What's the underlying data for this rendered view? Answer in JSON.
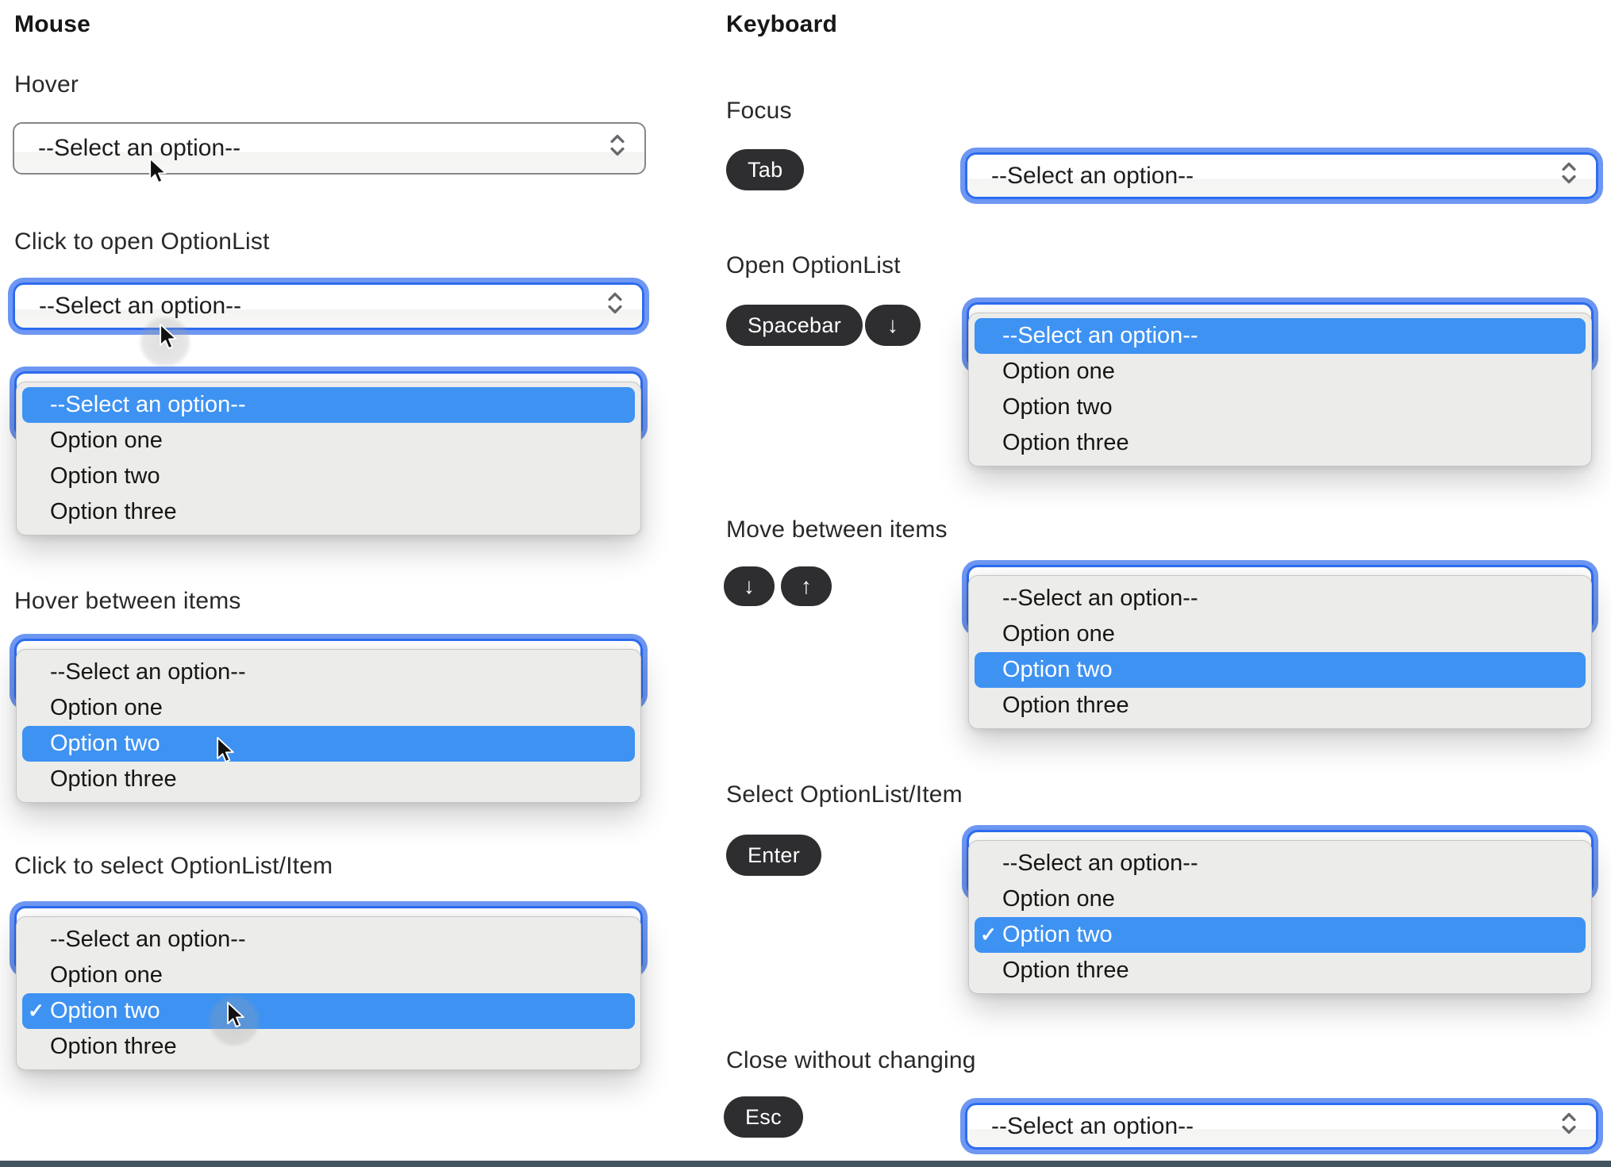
{
  "select": {
    "placeholder": "--Select an option--",
    "options": [
      "--Select an option--",
      "Option one",
      "Option two",
      "Option three"
    ],
    "check_glyph": "✓"
  },
  "mouse": {
    "heading": "Mouse",
    "hover": {
      "label": "Hover"
    },
    "click_open": {
      "label": "Click to open OptionList",
      "highlighted_option": "--Select an option--"
    },
    "hover_items": {
      "label": "Hover between items",
      "highlighted_option": "Option two"
    },
    "click_select": {
      "label": "Click to select OptionList/Item",
      "selected_option": "Option two"
    }
  },
  "keyboard": {
    "heading": "Keyboard",
    "focus": {
      "label": "Focus",
      "key": "Tab"
    },
    "open": {
      "label": "Open OptionList",
      "keys": [
        "Spacebar",
        "↓"
      ],
      "highlighted_option": "--Select an option--"
    },
    "move": {
      "label": "Move between items",
      "keys": [
        "↓",
        "↑"
      ],
      "highlighted_option": "Option two"
    },
    "select_item": {
      "label": "Select OptionList/Item",
      "key": "Enter",
      "selected_option": "Option two"
    },
    "close": {
      "label": "Close without changing",
      "key": "Esc"
    }
  }
}
